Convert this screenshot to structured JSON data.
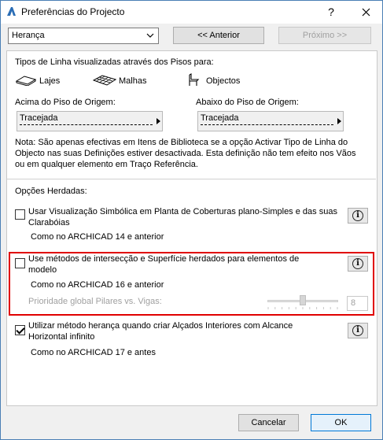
{
  "window": {
    "title": "Preferências do Projecto"
  },
  "toolbar": {
    "category_value": "Herança",
    "prev_label": "<< Anterior",
    "next_label": "Próximo >>"
  },
  "line_types": {
    "heading": "Tipos de Linha visualizadas através dos Pisos para:",
    "items": [
      {
        "label": "Lajes",
        "icon": "slab-icon"
      },
      {
        "label": "Malhas",
        "icon": "mesh-icon"
      },
      {
        "label": "Objectos",
        "icon": "object-icon"
      }
    ],
    "above_label": "Acima do Piso de Origem:",
    "above_value": "Tracejada",
    "below_label": "Abaixo do Piso de Origem:",
    "below_value": "Tracejada",
    "note_lines": [
      "Nota: São apenas efectivas em Itens de Biblioteca se a opção Activar Tipo de Linha do",
      "Objecto nas suas Definições estiver desactivada. Esta definição não tem efeito nos Vãos",
      "ou em qualquer elemento em Traço Referência."
    ]
  },
  "inherited": {
    "heading": "Opções Herdadas:",
    "options": [
      {
        "checked": false,
        "label_lines": [
          "Usar Visualização Simbólica em Planta de Coberturas plano-Simples e das suas",
          "Clarabóias"
        ],
        "sub": "Como no ARCHICAD 14 e anterior"
      },
      {
        "checked": false,
        "label_lines": [
          "Use métodos de intersecção e Superfície herdados para elementos de",
          "modelo"
        ],
        "sub": "Como no ARCHICAD 16 e anterior",
        "priority_label": "Prioridade global Pilares vs. Vigas:",
        "priority_value": "8",
        "priority_fraction": 0.5
      },
      {
        "checked": true,
        "label_lines": [
          "Utilizar método herança quando criar Alçados Interiores com Alcance",
          "Horizontal infinito"
        ],
        "sub": "Como no ARCHICAD 17 e antes"
      }
    ]
  },
  "footer": {
    "cancel_label": "Cancelar",
    "ok_label": "OK"
  },
  "colors": {
    "highlight_border": "#e00000",
    "window_border": "#4a7fb5"
  }
}
